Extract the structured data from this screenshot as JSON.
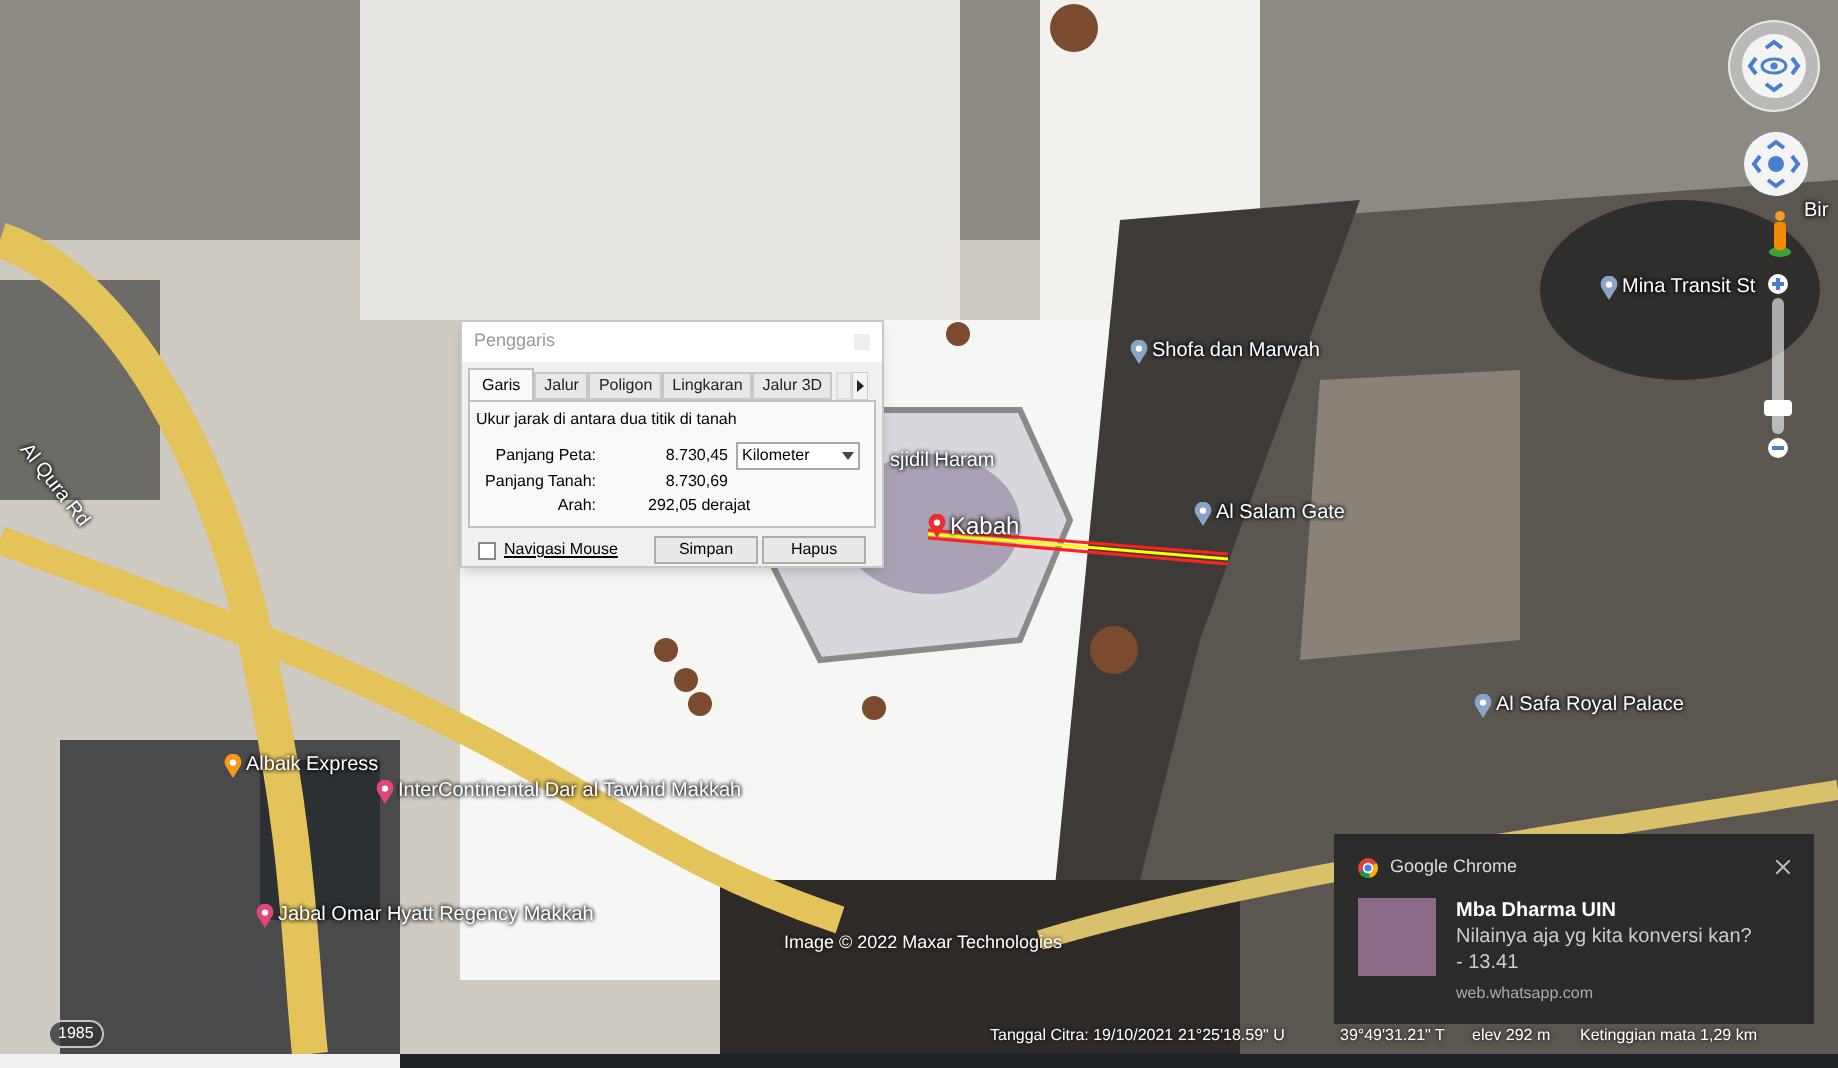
{
  "map_labels": [
    {
      "text": "Al Qura Rd",
      "kind": "road"
    },
    {
      "text": "Albaik Express",
      "kind": "food"
    },
    {
      "text": "InterContinental Dar al Tawhid Makkah",
      "kind": "hotel"
    },
    {
      "text": "Jabal Omar Hyatt Regency Makkah",
      "kind": "hotel"
    },
    {
      "text": "sjidil Haram",
      "kind": "plain"
    },
    {
      "text": "Kabah",
      "kind": "placemark"
    },
    {
      "text": "Shofa dan Marwah",
      "kind": "poi"
    },
    {
      "text": "Al Salam Gate",
      "kind": "poi"
    },
    {
      "text": "Mina Transit St",
      "kind": "poi"
    },
    {
      "text": "Al Safa Royal Palace",
      "kind": "poi"
    },
    {
      "text": "Bir",
      "kind": "plain"
    }
  ],
  "zoom": {
    "level": 0.15
  },
  "imagery_year": "1985",
  "credit": "Image © 2022 Maxar Technologies",
  "status_bar": [
    "Tanggal Citra: 19/10/2021",
    "21°25'18.59\" U",
    "39°49'31.21\" T",
    "elev 292 m",
    "Ketinggian mata 1,29 km"
  ],
  "ruler": {
    "title": "Penggaris",
    "tabs": [
      {
        "label": "Garis",
        "selected": true
      },
      {
        "label": "Jalur",
        "selected": false
      },
      {
        "label": "Poligon",
        "selected": false
      },
      {
        "label": "Lingkaran",
        "selected": false
      },
      {
        "label": "Jalur 3D",
        "selected": false
      }
    ],
    "description": "Ukur jarak di antara dua titik di tanah",
    "fields": [
      {
        "label": "Panjang Peta:",
        "value": "8.730,45"
      },
      {
        "label": "Panjang Tanah:",
        "value": "8.730,69"
      },
      {
        "label": "Arah:",
        "value": "292,05 derajat"
      }
    ],
    "unit": "Kilometer",
    "mouse_navigation": {
      "label": "Navigasi Mouse",
      "checked": false
    },
    "buttons": [
      "Simpan",
      "Hapus"
    ]
  },
  "notification": {
    "app": "Google Chrome",
    "title": "Mba Dharma UIN",
    "message": "Nilainya aja yg kita konversi kan?",
    "time": "- 13.41",
    "source": "web.whatsapp.com"
  }
}
